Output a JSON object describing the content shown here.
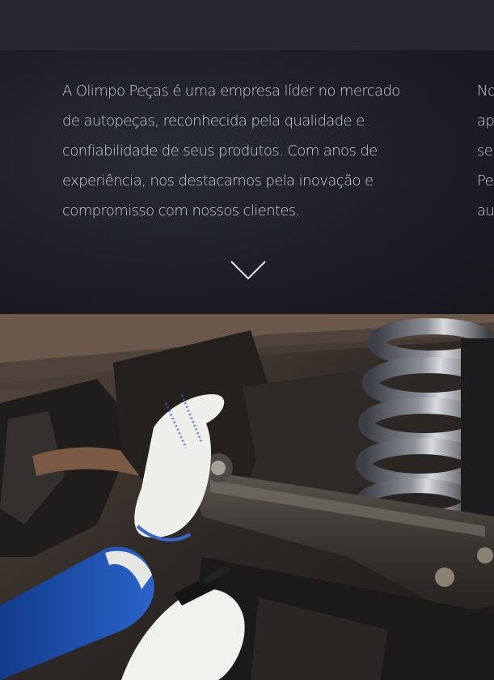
{
  "about": {
    "column1_lines": [
      "A Olimpo Peças é uma empresa líder no mercado",
      "de autopeças, reconhecida pela qualidade e",
      "confiabilidade de seus produtos. Com anos de",
      "experiência, nos destacamos pela inovação e",
      "compromisso com nossos clientes."
    ],
    "column2_lines": [
      "No",
      "ap",
      "se",
      "Pe",
      "au"
    ]
  },
  "icons": {
    "scroll": "chevron-down-icon"
  },
  "colors": {
    "topbar": "#26272f",
    "section_bg": "#1d1e26",
    "text": "#c9cbd3"
  }
}
